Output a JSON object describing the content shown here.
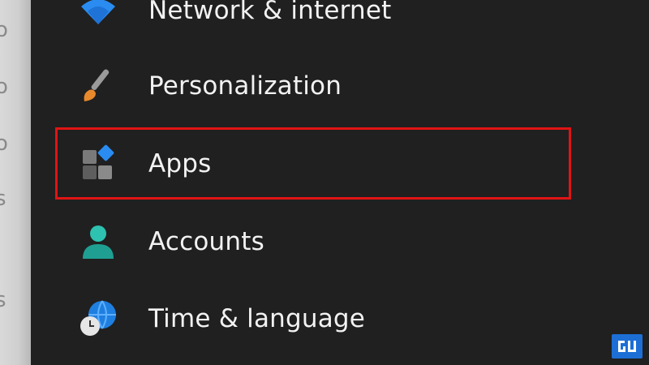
{
  "nav": {
    "items": [
      {
        "label": "Network & internet",
        "icon": "wifi-icon"
      },
      {
        "label": "Personalization",
        "icon": "paintbrush-icon"
      },
      {
        "label": "Apps",
        "icon": "apps-icon",
        "highlighted": true
      },
      {
        "label": "Accounts",
        "icon": "person-icon"
      },
      {
        "label": "Time & language",
        "icon": "globe-clock-icon"
      }
    ]
  },
  "colors": {
    "background": "#202020",
    "text": "#f2f2f2",
    "highlight": "#e11414",
    "accent_blue": "#1e90ff",
    "accounts_teal": "#23b5a6"
  },
  "watermark": {
    "icon": "gadgets-logo-icon"
  }
}
